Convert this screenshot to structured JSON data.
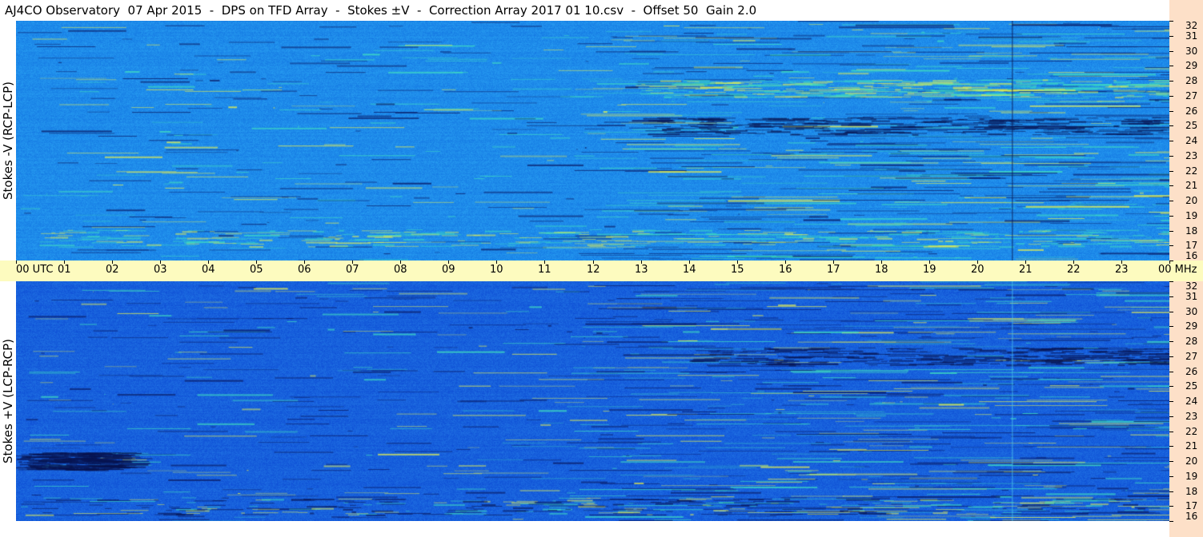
{
  "title": "AJ4CO Observatory  07 Apr 2015  -  DPS on TFD Array  -  Stokes ±V  -  Correction Array 2017 01 10.csv  -  Offset 50  Gain 2.0",
  "chart_data": {
    "type": "heatmap",
    "title": "AJ4CO Observatory  07 Apr 2015  -  DPS on TFD Array  -  Stokes ±V  -  Correction Array 2017 01 10.csv  -  Offset 50  Gain 2.0",
    "x_axis": {
      "labels": [
        "00 UTC",
        "01",
        "02",
        "03",
        "04",
        "05",
        "06",
        "07",
        "08",
        "09",
        "10",
        "11",
        "12",
        "13",
        "14",
        "15",
        "16",
        "17",
        "18",
        "19",
        "20",
        "21",
        "22",
        "23",
        "00 MHz"
      ],
      "range_hours": [
        0,
        24
      ]
    },
    "y_axis": {
      "labels": [
        "16",
        "17",
        "18",
        "19",
        "20",
        "21",
        "22",
        "23",
        "24",
        "25",
        "26",
        "27",
        "28",
        "29",
        "30",
        "31",
        "32"
      ],
      "range_mhz": [
        16,
        32
      ],
      "unit": "MHz"
    },
    "panels": [
      {
        "name": "Stokes -V (RCP-LCP)",
        "base_color": "#1e8bea"
      },
      {
        "name": "Stokes +V (LCP-RCP)",
        "base_color": "#1760dc"
      }
    ],
    "features": [
      {
        "panel": 0,
        "freq_mhz": 27.5,
        "hours": [
          13.0,
          24.0
        ],
        "note": "bright yellow-green band"
      },
      {
        "panel": 0,
        "freq_mhz": 17.5,
        "hours": [
          0.0,
          24.0
        ],
        "note": "bright band"
      },
      {
        "panel": 0,
        "freq_mhz": 25.0,
        "hours": [
          13.0,
          24.0
        ],
        "note": "dark line"
      },
      {
        "panel": 1,
        "freq_mhz": 27.0,
        "hours": [
          14.0,
          24.0
        ],
        "note": "dark band"
      },
      {
        "panel": 1,
        "freq_mhz": 17.0,
        "hours": [
          0.0,
          24.0
        ],
        "note": "dark / bright lines"
      },
      {
        "panel": 1,
        "freq_mhz": 20.0,
        "hours": [
          0.0,
          2.2
        ],
        "note": "dark line"
      }
    ]
  },
  "colors": {
    "title_bg": "#ffffff",
    "axis_strip": "#fde0c8",
    "time_axis_bg": "#fdfbbf",
    "top_base": "#1e8bea",
    "bottom_base": "#1760dc",
    "highlight_yellow": "#e8f050",
    "highlight_green": "#40e0c0",
    "dark": "#0a1e6a"
  }
}
